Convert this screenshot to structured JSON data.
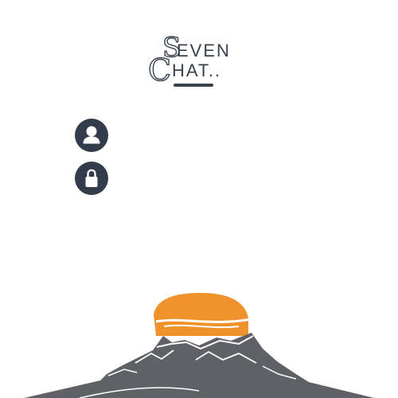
{
  "app": {
    "logo_initial_top": "S",
    "logo_rest_top": "EVEN",
    "logo_initial_bottom": "C",
    "logo_rest_bottom": "HAT.."
  },
  "login": {
    "username_icon": "user-icon",
    "password_icon": "lock-icon",
    "username_value": "",
    "password_value": ""
  },
  "colors": {
    "icon_background": "#333c4a",
    "sun": "#f0922b",
    "mountain": "#5f6166",
    "background": "#ffffff"
  }
}
